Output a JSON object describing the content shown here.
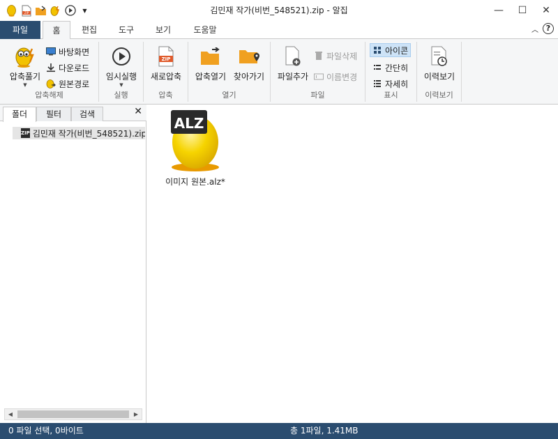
{
  "window": {
    "title": "김민재 작가(비번_548521).zip - 알집",
    "quick_access": [
      "app-egg-icon",
      "new-zip-icon",
      "open-folder-icon",
      "extract-icon",
      "play-icon",
      "customize-dropdown-icon"
    ],
    "controls": {
      "minimize": "—",
      "maximize": "☐",
      "close": "✕"
    }
  },
  "ribbon_tabs": {
    "file": "파일",
    "tabs": [
      "홈",
      "편집",
      "도구",
      "보기",
      "도움말"
    ],
    "active": "홈",
    "help": "?"
  },
  "ribbon": {
    "extract_group": {
      "label": "압축해제",
      "extract_button": "압축풀기",
      "to_desktop": "바탕화면",
      "to_downloads": "다운로드",
      "to_original_path": "원본경로"
    },
    "run_group": {
      "label": "실행",
      "temp_run": "임시실행"
    },
    "compress_group": {
      "label": "압축",
      "new_archive": "새로압축"
    },
    "open_group": {
      "label": "열기",
      "open_archive": "압축열기",
      "find": "찾아가기"
    },
    "file_group": {
      "label": "파일",
      "add_file": "파일추가",
      "delete_file": "파일삭제",
      "rename": "이름변경"
    },
    "view_group": {
      "label": "표시",
      "icon": "아이콘",
      "simple": "간단히",
      "detail": "자세히",
      "selected": "아이콘"
    },
    "history_group": {
      "label": "이력보기",
      "history": "이력보기"
    }
  },
  "left_panel": {
    "tabs": [
      "폴더",
      "필터",
      "검색"
    ],
    "active_tab": "폴더",
    "close": "✕",
    "tree_item": "김민재 작가(비번_548521).zip",
    "zip_badge": "ZIP"
  },
  "main": {
    "files": [
      {
        "name": "이미지 원본.alz*",
        "badge": "ALZ"
      }
    ]
  },
  "status": {
    "left": "0 파일 선택,  0바이트",
    "right": "총 1파일,  1.41MB"
  },
  "colors": {
    "accent": "#2b4d70",
    "ribbon_bg": "#f5f6f7",
    "egg_yellow": "#f2c200",
    "zip_red": "#e05a2b",
    "folder_orange": "#f0a020"
  }
}
